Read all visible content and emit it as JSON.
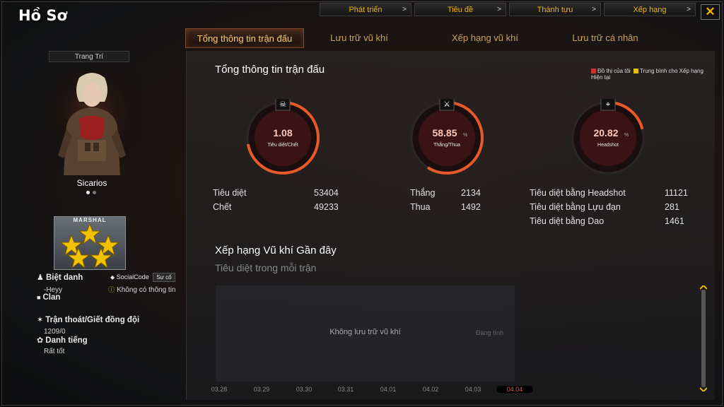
{
  "title": "Hồ Sơ",
  "top_nav": [
    {
      "label": "Phát triển"
    },
    {
      "label": "Tiêu đề"
    },
    {
      "label": "Thành tựu"
    },
    {
      "label": "Xếp hạng"
    }
  ],
  "close_glyph": "✕",
  "tabs": [
    {
      "label": "Tổng thông tin trận đấu",
      "active": true
    },
    {
      "label": "Lưu trữ vũ khí"
    },
    {
      "label": "Xếp hạng vũ khí"
    },
    {
      "label": "Lưu trữ cá nhân"
    }
  ],
  "profile": {
    "decoration_label": "Trang Trí",
    "character_name": "Sicarios",
    "rank_name": "MARSHAL",
    "nickname_label": "Biệt danh",
    "nickname": "-Heyy",
    "social_code_label": "SocialCode",
    "social_code_button": "Sự cố",
    "social_code_value": "Không có thông tin",
    "clan_label": "Clan",
    "escape_label": "Trận thoát/Giết đồng đội",
    "escape_value": "1209/0",
    "reputation_label": "Danh tiếng",
    "reputation_value": "Rất tốt"
  },
  "summary": {
    "title": "Tổng thông tin trận đấu",
    "legend_mine": "Đồ thị của tôi",
    "legend_avg": "Trung bình cho Xếp hạng Hiện tại",
    "colors": {
      "mine": "#cc3333",
      "avg": "#e0c000",
      "accent": "#e85a2a"
    },
    "gauges": [
      {
        "value": "1.08",
        "unit": "",
        "label": "Tiêu diệt/Chết",
        "icon": "skull-icon",
        "fill": 0.72
      },
      {
        "value": "58.85",
        "unit": "%",
        "label": "Thắng/Thua",
        "icon": "crossed-rifles-icon",
        "fill": 0.59
      },
      {
        "value": "20.82",
        "unit": "%",
        "label": "Headshot",
        "icon": "sniper-icon",
        "fill": 0.21
      }
    ],
    "stats_col1": [
      {
        "label": "Tiêu diệt",
        "value": "53404"
      },
      {
        "label": "Chết",
        "value": "49233"
      }
    ],
    "stats_col2": [
      {
        "label": "Thắng",
        "value": "2134"
      },
      {
        "label": "Thua",
        "value": "1492"
      }
    ],
    "stats_col3": [
      {
        "label": "Tiêu diệt bằng Headshot",
        "value": "11121"
      },
      {
        "label": "Tiêu diệt bằng Lựu đạn",
        "value": "281"
      },
      {
        "label": "Tiêu diệt bằng Dao",
        "value": "1461"
      }
    ]
  },
  "weapon_ranking": {
    "title": "Xếp hạng Vũ khí Gần đây",
    "subtitle": "Tiêu diệt trong mỗi trận",
    "empty_text": "Không lưu trữ vũ khí",
    "pending_text": "Đang tính",
    "dates": [
      "03.28",
      "03.29",
      "03.30",
      "03.31",
      "04.01",
      "04.02",
      "04.03",
      "04.04"
    ],
    "active_date": "04.04"
  }
}
